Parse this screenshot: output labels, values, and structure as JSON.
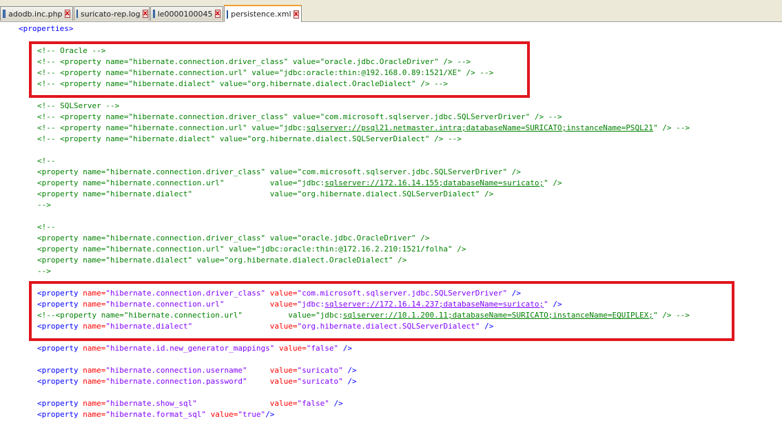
{
  "tabs": [
    {
      "label": "adodb.inc.php",
      "active": false
    },
    {
      "label": "suricato-rep.log",
      "active": false
    },
    {
      "label": "le0000100045",
      "active": false
    },
    {
      "label": "persistence.xml",
      "active": true
    }
  ],
  "close_glyph": "x",
  "code": {
    "root_open": "<properties>",
    "oracle_block": [
      "<!-- Oracle -->",
      "<!-- <property name=\"hibernate.connection.driver_class\" value=\"oracle.jdbc.OracleDriver\" /> -->",
      "<!-- <property name=\"hibernate.connection.url\" value=\"jdbc:oracle:thin:@192.168.0.89:1521/XE\" /> -->",
      "<!-- <property name=\"hibernate.dialect\" value=\"org.hibernate.dialect.OracleDialect\" /> -->"
    ],
    "sqlserver_block": {
      "l1": "<!-- SQLServer -->",
      "l2": "<!-- <property name=\"hibernate.connection.driver_class\" value=\"com.microsoft.sqlserver.jdbc.SQLServerDriver\" /> -->",
      "l3_pre": "<!-- <property name=\"hibernate.connection.url\" value=\"jdbc:",
      "l3_link": "sqlserver://psql21.netmaster.intra;databaseName=SURICATO;instanceName=PSQL21",
      "l3_post": "\" /> -->",
      "l4": "<!-- <property name=\"hibernate.dialect\" value=\"org.hibernate.dialect.SQLServerDialect\" /> -->"
    },
    "comment_block_1": {
      "open": "<!--",
      "l1": "<property name=\"hibernate.connection.driver_class\" value=\"com.microsoft.sqlserver.jdbc.SQLServerDriver\" />",
      "l2_pre": "<property name=\"hibernate.connection.url\"          value=\"jdbc:",
      "l2_link": "sqlserver://172.16.14.155;databaseName=suricato;",
      "l2_post": "\" />",
      "l3": "<property name=\"hibernate.dialect\"                 value=\"org.hibernate.dialect.SQLServerDialect\" />",
      "close": "-->"
    },
    "comment_block_2": {
      "open": "<!--",
      "l1": "<property name=\"hibernate.connection.driver_class\" value=\"oracle.jdbc.OracleDriver\" />",
      "l2": "<property name=\"hibernate.connection.url\" value=\"jdbc:oracle:thin:@172.16.2.210:1521/folha\" />",
      "l3": "<property name=\"hibernate.dialect\" value=\"org.hibernate.dialect.OracleDialect\" />",
      "close": "-->"
    },
    "active_block": {
      "tag": "<property",
      "attr": "name=",
      "valattr": "value=",
      "end": "/>",
      "driver_name": "\"hibernate.connection.driver_class\"",
      "driver_value": "\"com.microsoft.sqlserver.jdbc.SQLServerDriver\"",
      "url_name": "\"hibernate.connection.url\"",
      "url_value_pre": "\"jdbc:",
      "url_value_link": "sqlserver://172.16.14.237;databaseName=suricato;",
      "url_value_post": "\"",
      "commented_pre": "<!--<property name=\"hibernate.connection.url\"          value=\"jdbc:",
      "commented_link": "sqlserver://10.1.200.11;databaseName=SURICATO;instanceName=EQUIPLEX;",
      "commented_post": "\" /> -->",
      "dialect_name": "\"hibernate.dialect\"",
      "dialect_value": "\"org.hibernate.dialect.SQLServerDialect\""
    },
    "generator": {
      "name": "\"hibernate.id.new_generator_mappings\"",
      "value": "\"false\""
    },
    "username": {
      "name": "\"hibernate.connection.username\"",
      "value": "\"suricato\""
    },
    "password": {
      "name": "\"hibernate.connection.password\"",
      "value": "\"suricato\""
    },
    "show_sql": {
      "name": "\"hibernate.show_sql\"",
      "value": "\"false\""
    },
    "format_sql": {
      "name": "\"hibernate.format_sql\"",
      "value": "\"true\""
    }
  },
  "colors": {
    "comment": "#008000",
    "tag": "#0000ff",
    "attribute": "#ff0000",
    "value": "#8000ff",
    "highlight": "#e0161c"
  }
}
